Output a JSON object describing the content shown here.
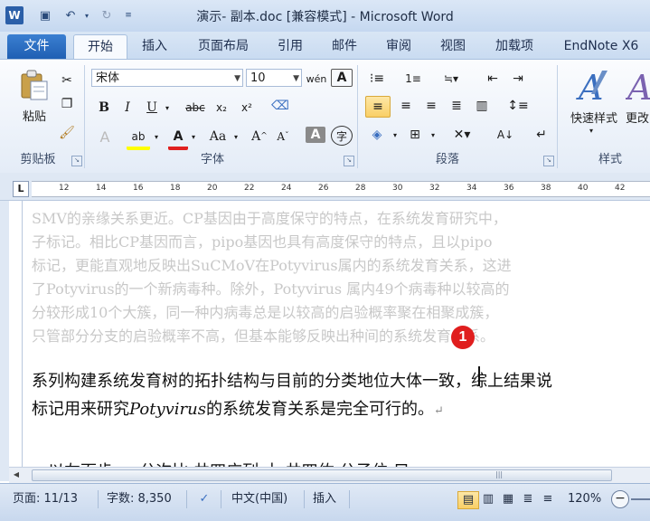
{
  "window": {
    "title": "演示- 副本.doc [兼容模式] - Microsoft Word"
  },
  "tabs": [
    {
      "label": "文件"
    },
    {
      "label": "开始"
    },
    {
      "label": "插入"
    },
    {
      "label": "页面布局"
    },
    {
      "label": "引用"
    },
    {
      "label": "邮件"
    },
    {
      "label": "审阅"
    },
    {
      "label": "视图"
    },
    {
      "label": "加载项"
    },
    {
      "label": "EndNote X6"
    }
  ],
  "ribbon": {
    "clipboard": {
      "paste_label": "粘贴",
      "group_label": "剪贴板"
    },
    "font": {
      "font_name": "宋体",
      "font_size": "10",
      "group_label": "字体"
    },
    "paragraph": {
      "group_label": "段落"
    },
    "styles": {
      "quick_styles_label": "快速样式",
      "change_styles_label": "更改",
      "group_label": "样式"
    }
  },
  "ruler": {
    "ticks": [
      "12",
      "14",
      "16",
      "18",
      "20",
      "22",
      "24",
      "26",
      "28",
      "30",
      "32",
      "34",
      "36",
      "38",
      "40",
      "42"
    ]
  },
  "document": {
    "faded_lines": [
      "SMV的亲缘关系更近。CP基因由于高度保守的特点，在系统发育研究中，",
      "子标记。相比CP基因而言，pipo基因也具有高度保守的特点，且以pipo",
      "标记，更能直观地反映出SuCMoV在Potyvirus属内的系统发育关系，这进",
      "了Potyvirus的一个新病毒种。除外，Potyvirus 属内49个病毒种以较高的",
      "分较形成10个大簇，同一种内病毒总是以较高的启验概率聚在相聚成簇，",
      "只管部分分支的启验概率不高，但基本能够反映出种间的系统发育关系。"
    ],
    "line1": "系列构建系统发育树的拓扑结构与目前的分类地位大体一致，综上结果说",
    "line2_a": "标记用来研究",
    "line2_italic": "Potyvirus",
    "line2_b": "的系统发育关系是完全可行的。",
    "paragraph_mark": "↵",
    "bottom_partial": "，以左面步     ，         公次比          井四广列      土       井四佑      公子位 只"
  },
  "marker": {
    "number": "1"
  },
  "status": {
    "page": "页面: 11/13",
    "words": "字数: 8,350",
    "language": "中文(中国)",
    "mode": "插入",
    "zoom": "120%"
  }
}
